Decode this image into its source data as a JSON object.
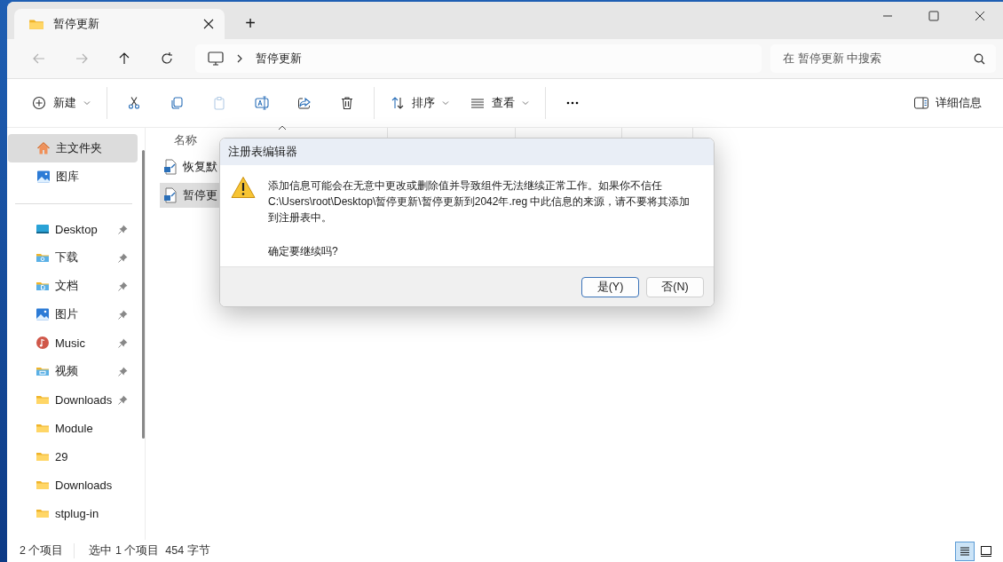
{
  "tab": {
    "title": "暂停更新",
    "new_tab": "+"
  },
  "nav": {
    "buttons": [
      {
        "kind": "back",
        "disabled": true
      },
      {
        "kind": "forward",
        "disabled": true
      },
      {
        "kind": "up",
        "disabled": false
      },
      {
        "kind": "refresh",
        "disabled": false
      }
    ],
    "breadcrumbs": [
      "暂停更新"
    ],
    "search_placeholder": "在 暂停更新 中搜索"
  },
  "command_bar": {
    "groups": [
      {
        "items": [
          {
            "kind": "new",
            "label": "新建",
            "dropdown": true,
            "disabled": false
          }
        ]
      },
      {
        "items": [
          {
            "kind": "cut",
            "dropdown": false,
            "disabled": false
          },
          {
            "kind": "copy",
            "dropdown": false,
            "disabled": false
          },
          {
            "kind": "paste",
            "dropdown": false,
            "disabled": true
          },
          {
            "kind": "rename",
            "dropdown": false,
            "disabled": false
          },
          {
            "kind": "share",
            "dropdown": false,
            "disabled": false
          },
          {
            "kind": "delete",
            "dropdown": false,
            "disabled": false
          }
        ]
      },
      {
        "items": [
          {
            "kind": "sort",
            "label": "排序",
            "dropdown": true,
            "disabled": false
          },
          {
            "kind": "view",
            "label": "查看",
            "dropdown": true,
            "disabled": false
          }
        ]
      },
      {
        "items": [
          {
            "kind": "more",
            "dropdown": false,
            "disabled": false
          }
        ]
      }
    ],
    "details_label": "详细信息"
  },
  "sidebar": {
    "sections": [
      {
        "items": [
          {
            "kind": "home",
            "label": "主文件夹",
            "pinned": false,
            "selected": true
          },
          {
            "kind": "gallery",
            "label": "图库",
            "pinned": false,
            "selected": false
          }
        ]
      },
      {
        "items": [
          {
            "kind": "desktop",
            "label": "Desktop",
            "pinned": true,
            "selected": false
          },
          {
            "kind": "downloads",
            "label": "下载",
            "pinned": true,
            "selected": false
          },
          {
            "kind": "documents",
            "label": "文档",
            "pinned": true,
            "selected": false
          },
          {
            "kind": "pictures",
            "label": "图片",
            "pinned": true,
            "selected": false
          },
          {
            "kind": "music",
            "label": "Music",
            "pinned": true,
            "selected": false
          },
          {
            "kind": "videos",
            "label": "视频",
            "pinned": true,
            "selected": false
          },
          {
            "kind": "folder",
            "label": "Downloads",
            "pinned": true,
            "selected": false
          },
          {
            "kind": "folder",
            "label": "Module",
            "pinned": false,
            "selected": false
          },
          {
            "kind": "folder",
            "label": "29",
            "pinned": false,
            "selected": false
          },
          {
            "kind": "folder",
            "label": "Downloads",
            "pinned": false,
            "selected": false
          },
          {
            "kind": "folder",
            "label": "stplug-in",
            "pinned": false,
            "selected": false
          }
        ]
      }
    ]
  },
  "file_list": {
    "columns": [
      {
        "label": "名称",
        "sorted": true
      }
    ],
    "files": [
      {
        "name": "恢复默",
        "selected": false
      },
      {
        "name": "暂停更",
        "selected": true
      }
    ]
  },
  "dialog": {
    "title": "注册表编辑器",
    "message": "添加信息可能会在无意中更改或删除值并导致组件无法继续正常工作。如果你不信任 C:\\Users\\root\\Desktop\\暂停更新\\暂停更新到2042年.reg 中此信息的来源，请不要将其添加到注册表中。",
    "question": "确定要继续吗?",
    "buttons": [
      {
        "label": "是(Y)",
        "default": true
      },
      {
        "label": "否(N)",
        "default": false
      }
    ]
  },
  "status_bar": {
    "item_count": "2 个项目",
    "selection": "选中 1 个项目",
    "size": "454 字节",
    "view_buttons": [
      {
        "kind": "details",
        "selected": true
      },
      {
        "kind": "tiles",
        "selected": false
      }
    ]
  }
}
